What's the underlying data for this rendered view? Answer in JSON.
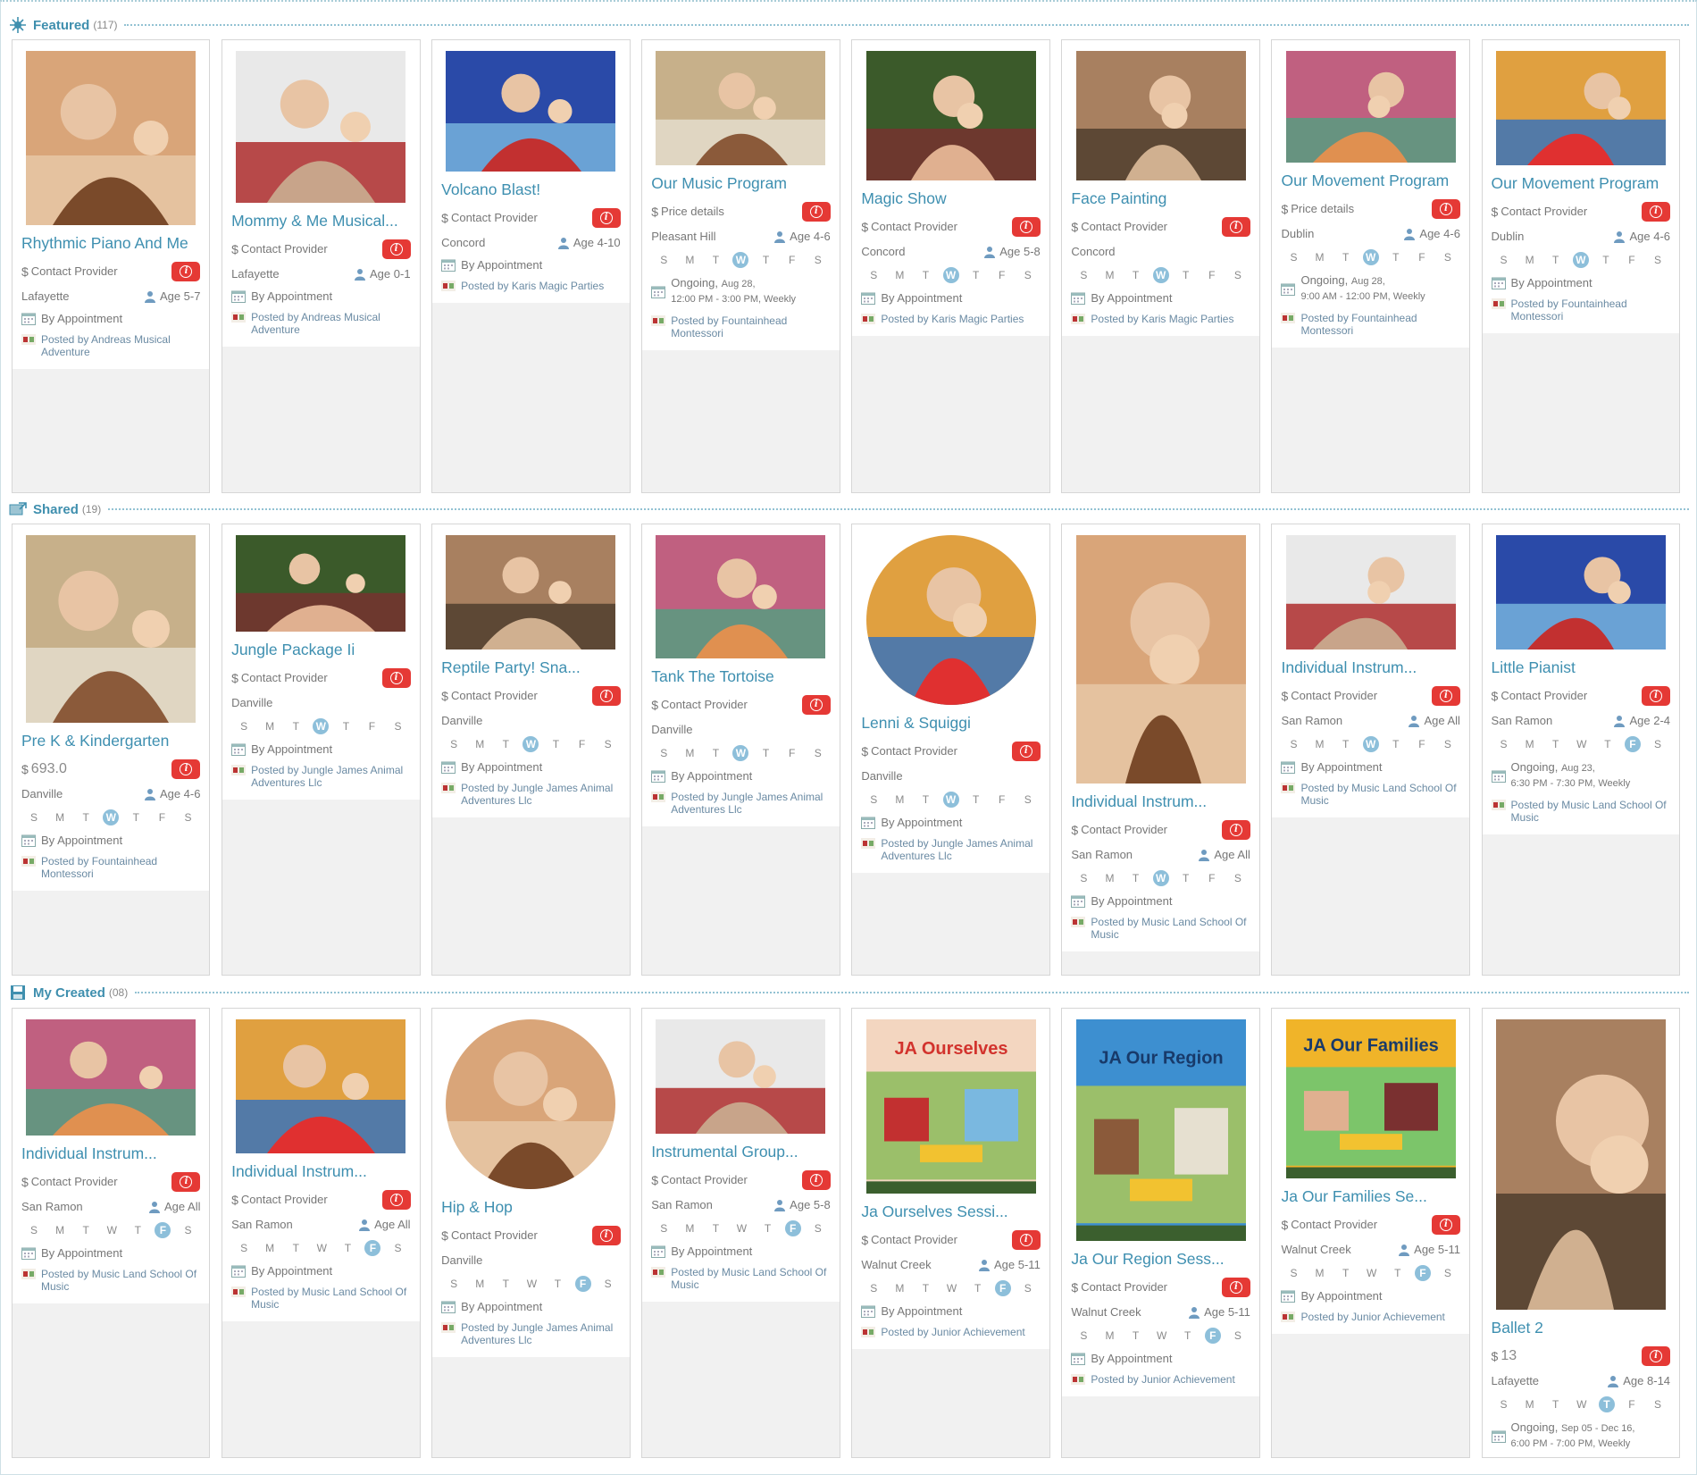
{
  "sections": [
    {
      "title": "Featured",
      "count": "(117)",
      "cards": [
        {
          "title": "Rhythmic Piano And Me",
          "price": "Contact Provider",
          "city": "Lafayette",
          "age": "Age  5-7",
          "schedule": "By Appointment",
          "posted": "Posted by Andreas Musical Adventure"
        },
        {
          "title": "Mommy & Me Musical...",
          "price": "Contact Provider",
          "city": "Lafayette",
          "age": "Age  0-1",
          "schedule": "By Appointment",
          "posted": "Posted by Andreas Musical Adventure"
        },
        {
          "title": "Volcano Blast!",
          "price": "Contact Provider",
          "city": "Concord",
          "age": "Age  4-10",
          "schedule": "By Appointment",
          "posted": "Posted by Karis Magic Parties"
        },
        {
          "title": "Our Music Program",
          "price": "Price details",
          "city": "Pleasant Hill",
          "age": "Age  4-6",
          "days": [
            "S",
            "M",
            "T",
            "W",
            "T",
            "F",
            "S"
          ],
          "schedule": "Ongoing,",
          "schedule_date": "Aug 28,",
          "schedule_time": "12:00 PM - 3:00 PM, Weekly",
          "posted": "Posted by Fountainhead Montessori"
        },
        {
          "title": "Magic Show",
          "price": "Contact Provider",
          "city": "Concord",
          "age": "Age  5-8",
          "days": [
            "S",
            "M",
            "T",
            "W",
            "T",
            "F",
            "S"
          ],
          "schedule": "By Appointment",
          "posted": "Posted by Karis Magic Parties"
        },
        {
          "title": "Face Painting",
          "price": "Contact Provider",
          "city": "Concord",
          "days": [
            "S",
            "M",
            "T",
            "W",
            "T",
            "F",
            "S"
          ],
          "schedule": "By Appointment",
          "posted": "Posted by Karis Magic Parties"
        },
        {
          "title": "Our Movement Program",
          "price": "Price details",
          "city": "Dublin",
          "age": "Age  4-6",
          "days": [
            "S",
            "M",
            "T",
            "W",
            "T",
            "F",
            "S"
          ],
          "schedule": "Ongoing,",
          "schedule_date": "Aug 28,",
          "schedule_time": "9:00 AM - 12:00 PM, Weekly",
          "posted": "Posted by Fountainhead Montessori"
        },
        {
          "title": "Our Movement Program",
          "price": "Contact Provider",
          "city": "Dublin",
          "age": "Age  4-6",
          "days": [
            "S",
            "M",
            "T",
            "W",
            "T",
            "F",
            "S"
          ],
          "schedule": "By Appointment",
          "posted": "Posted by Fountainhead Montessori"
        }
      ]
    },
    {
      "title": "Shared",
      "count": "(19)",
      "cards": [
        {
          "title": "Pre K & Kindergarten",
          "price": "693.0",
          "city": "Danville",
          "age": "Age  4-6",
          "days": [
            "S",
            "M",
            "T",
            "W",
            "T",
            "F",
            "S"
          ],
          "schedule": "By Appointment",
          "posted": "Posted by Fountainhead Montessori"
        },
        {
          "title": "Jungle Package Ii",
          "price": "Contact Provider",
          "city": "Danville",
          "days": [
            "S",
            "M",
            "T",
            "W",
            "T",
            "F",
            "S"
          ],
          "schedule": "By Appointment",
          "posted": "Posted by Jungle James Animal Adventures Llc"
        },
        {
          "title": "Reptile Party! Sna...",
          "price": "Contact Provider",
          "city": "Danville",
          "days": [
            "S",
            "M",
            "T",
            "W",
            "T",
            "F",
            "S"
          ],
          "schedule": "By Appointment",
          "posted": "Posted by Jungle James Animal Adventures Llc"
        },
        {
          "title": "Tank The Tortoise",
          "price": "Contact Provider",
          "city": "Danville",
          "days": [
            "S",
            "M",
            "T",
            "W",
            "T",
            "F",
            "S"
          ],
          "schedule": "By Appointment",
          "posted": "Posted by Jungle James Animal Adventures Llc"
        },
        {
          "title": "Lenni & Squiggi",
          "price": "Contact Provider",
          "city": "Danville",
          "days": [
            "S",
            "M",
            "T",
            "W",
            "T",
            "F",
            "S"
          ],
          "schedule": "By Appointment",
          "posted": "Posted by Jungle James Animal Adventures Llc"
        },
        {
          "title": "Individual Instrum...",
          "price": "Contact Provider",
          "city": "San Ramon",
          "age": "Age  All",
          "days": [
            "S",
            "M",
            "T",
            "W",
            "T",
            "F",
            "S"
          ],
          "schedule": "By Appointment",
          "posted": "Posted by Music Land School Of Music"
        },
        {
          "title": "Individual Instrum...",
          "price": "Contact Provider",
          "city": "San Ramon",
          "age": "Age  All",
          "days": [
            "S",
            "M",
            "T",
            "W",
            "T",
            "F",
            "S"
          ],
          "schedule": "By Appointment",
          "posted": "Posted by Music Land School Of Music"
        },
        {
          "title": "Little Pianist",
          "price": "Contact Provider",
          "city": "San Ramon",
          "age": "Age  2-4",
          "days": [
            "S",
            "M",
            "T",
            "W",
            "T",
            "F",
            "S"
          ],
          "schedule": "Ongoing,",
          "schedule_date": "Aug 23,",
          "schedule_time": "6:30 PM - 7:30 PM, Weekly",
          "posted": "Posted by Music Land School Of Music"
        }
      ]
    },
    {
      "title": "My Created",
      "count": "(08)",
      "cards": [
        {
          "title": "Individual Instrum...",
          "price": "Contact Provider",
          "city": "San Ramon",
          "age": "Age  All",
          "days": [
            "S",
            "M",
            "T",
            "W",
            "T",
            "F",
            "S"
          ],
          "schedule": "By Appointment",
          "posted": "Posted by Music Land School Of Music"
        },
        {
          "title": "Individual Instrum...",
          "price": "Contact Provider",
          "city": "San Ramon",
          "age": "Age  All",
          "days": [
            "S",
            "M",
            "T",
            "W",
            "T",
            "F",
            "S"
          ],
          "schedule": "By Appointment",
          "posted": "Posted by Music Land School Of Music"
        },
        {
          "title": "Hip & Hop",
          "price": "Contact Provider",
          "city": "Danville",
          "days": [
            "S",
            "M",
            "T",
            "W",
            "T",
            "F",
            "S"
          ],
          "schedule": "By Appointment",
          "posted": "Posted by Jungle James Animal Adventures Llc"
        },
        {
          "title": "Instrumental Group...",
          "price": "Contact Provider",
          "city": "San Ramon",
          "age": "Age  5-8",
          "days": [
            "S",
            "M",
            "T",
            "W",
            "T",
            "F",
            "S"
          ],
          "schedule": "By Appointment",
          "posted": "Posted by Music Land School Of Music"
        },
        {
          "title": "Ja Ourselves Sessi...",
          "price": "Contact Provider",
          "city": "Walnut Creek",
          "age": "Age  5-11",
          "days": [
            "S",
            "M",
            "T",
            "W",
            "T",
            "F",
            "S"
          ],
          "schedule": "By Appointment",
          "posted": "Posted by Junior Achievement",
          "cover_text": "JA Ourselves"
        },
        {
          "title": "Ja Our Region Sess...",
          "price": "Contact Provider",
          "city": "Walnut Creek",
          "age": "Age  5-11",
          "days": [
            "S",
            "M",
            "T",
            "W",
            "T",
            "F",
            "S"
          ],
          "schedule": "By Appointment",
          "posted": "Posted by Junior Achievement",
          "cover_text": "JA Our Region"
        },
        {
          "title": "Ja Our Families Se...",
          "price": "Contact Provider",
          "city": "Walnut Creek",
          "age": "Age  5-11",
          "days": [
            "S",
            "M",
            "T",
            "W",
            "T",
            "F",
            "S"
          ],
          "schedule": "By Appointment",
          "posted": "Posted by Junior Achievement",
          "cover_text": "JA Our Families"
        },
        {
          "title": "Ballet 2",
          "price": "13",
          "city": "Lafayette",
          "age": "Age  8-14",
          "days": [
            "S",
            "M",
            "T",
            "W",
            "T",
            "F",
            "S"
          ],
          "schedule": "Ongoing,",
          "schedule_date": "Sep 05 - Dec 16,",
          "schedule_time": "6:00 PM - 7:00 PM, Weekly"
        }
      ]
    }
  ],
  "colors": {
    "accent": "#3e8fb0",
    "info": "#e53935",
    "day_on": "#8dbfda"
  }
}
